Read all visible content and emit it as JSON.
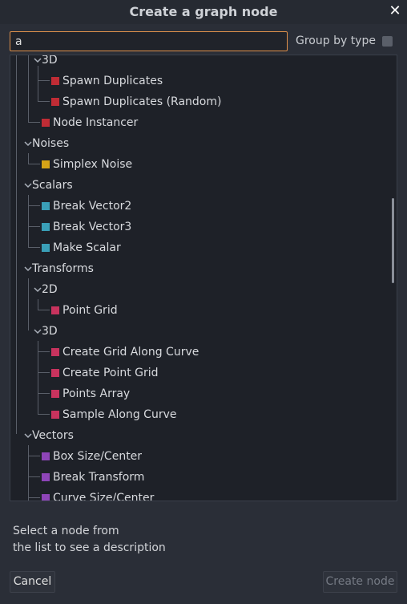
{
  "dialog": {
    "title": "Create a graph node",
    "close_glyph": "✕"
  },
  "search": {
    "value": "a",
    "placeholder": ""
  },
  "group_by_type": {
    "label": "Group by type",
    "checked": false
  },
  "tree": {
    "categories": {
      "spatial_3d": "3D",
      "noises": "Noises",
      "scalars": "Scalars",
      "transforms": "Transforms",
      "transforms_2d": "2D",
      "transforms_3d": "3D",
      "vectors": "Vectors"
    },
    "nodes": {
      "spawn_duplicates": "Spawn Duplicates",
      "spawn_duplicates_random": "Spawn Duplicates (Random)",
      "node_instancer": "Node Instancer",
      "simplex_noise": "Simplex Noise",
      "break_vector2": "Break Vector2",
      "break_vector3": "Break Vector3",
      "make_scalar": "Make Scalar",
      "point_grid": "Point Grid",
      "create_grid_along_curve": "Create Grid Along Curve",
      "create_point_grid": "Create Point Grid",
      "points_array": "Points Array",
      "sample_along_curve": "Sample Along Curve",
      "box_size_center": "Box Size/Center",
      "break_transform": "Break Transform",
      "curve_size_center": "Curve Size/Center"
    },
    "colors": {
      "spatial": "#c02c35",
      "noise": "#d6a317",
      "scalar": "#3a9fb7",
      "transform": "#c8335e",
      "vector": "#8e45b8"
    }
  },
  "description": {
    "line1": "Select a node from",
    "line2": "the list to see a description"
  },
  "buttons": {
    "cancel": "Cancel",
    "create": "Create node"
  }
}
